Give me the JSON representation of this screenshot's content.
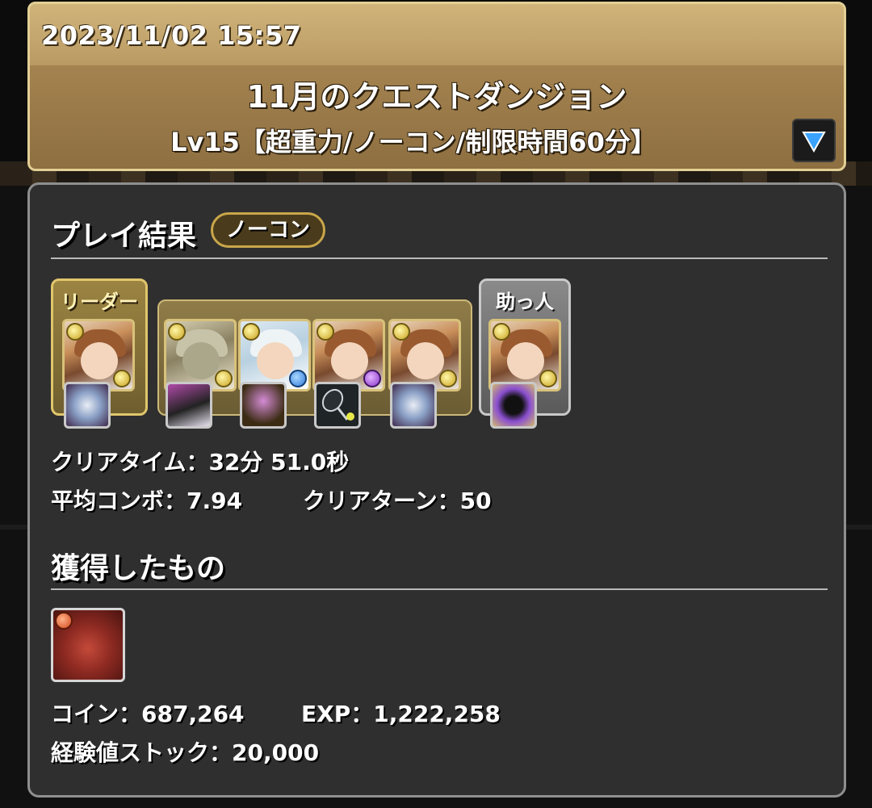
{
  "header": {
    "datetime": "2023/11/02 15:57",
    "title": "11月のクエストダンジョン",
    "subtitle": "Lv15【超重力/ノーコン/制限時間60分】",
    "dropdown_icon": "triangle-down-icon"
  },
  "result": {
    "section_title": "プレイ結果",
    "badge": "ノーコン",
    "leader_label": "リーダー",
    "helper_label": "助っ人",
    "clear_time": "クリアタイム：32分 51.0秒",
    "avg_combo": "平均コンボ：7.94",
    "clear_turn": "クリアターン：50"
  },
  "loot": {
    "section_title": "獲得したもの",
    "coins": "コイン：687,264",
    "exp": "EXP：1,222,258",
    "exp_stock": "経験値ストック：20,000"
  },
  "colors": {
    "header_gold": "#b8945b",
    "panel_bg": "#2f2f2f",
    "leader_frame": "#e0c66c",
    "helper_frame": "#c9c9c9",
    "dropdown_arrow": "#3aa3ff"
  }
}
